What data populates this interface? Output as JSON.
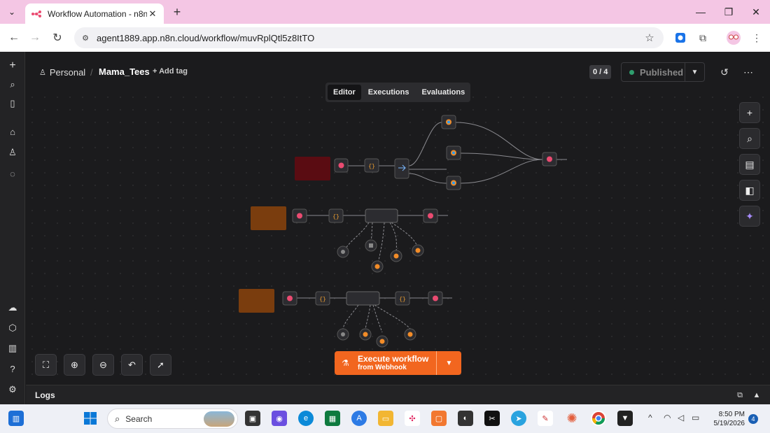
{
  "browser": {
    "tab_title": "Workflow Automation - n8n",
    "url": "agent1889.app.n8n.cloud/workflow/muvRplQtl5z8ItTO"
  },
  "header": {
    "project": "Personal",
    "workflow_name": "Mama_Tees",
    "add_tag": "+ Add tag",
    "counter": "0 / 4",
    "publish_label": "Published"
  },
  "tabs": [
    "Editor",
    "Executions",
    "Evaluations"
  ],
  "execute": {
    "line1": "Execute workflow",
    "line2": "from Webhook"
  },
  "logs_label": "Logs",
  "taskbar": {
    "search_placeholder": "Search",
    "time": "8:50 PM",
    "date": "5/19/2026",
    "notifications": "4"
  },
  "colors": {
    "accent": "#f2661f",
    "canvas": "#1b1b1d",
    "published_dot": "#2f9e6e",
    "browser_tabbar": "#f4c6e4"
  }
}
